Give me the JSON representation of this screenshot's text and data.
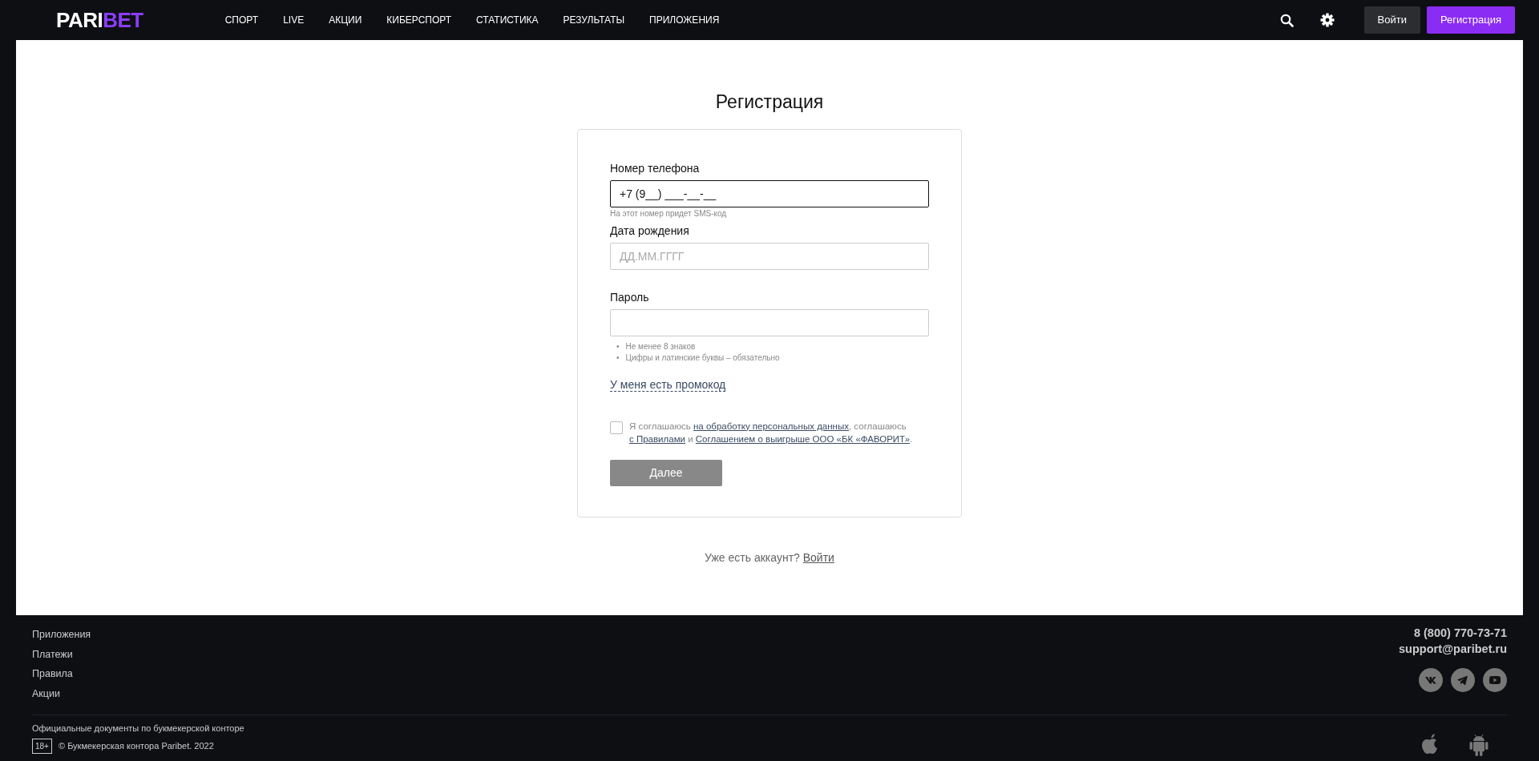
{
  "header": {
    "logo": {
      "light": "PARI",
      "accent": "BET"
    },
    "nav": [
      {
        "label": "СПОРТ"
      },
      {
        "label": "LIVE"
      },
      {
        "label": "АКЦИИ"
      },
      {
        "label": "КИБЕРСПОРТ"
      },
      {
        "label": "СТАТИСТИКА"
      },
      {
        "label": "РЕЗУЛЬТАТЫ"
      },
      {
        "label": "ПРИЛОЖЕНИЯ"
      }
    ],
    "login_button": "Войти",
    "register_button": "Регистрация"
  },
  "form": {
    "title": "Регистрация",
    "fields": [
      {
        "label": "Номер телефона",
        "value": "+7 (9__) ___-__-__",
        "focused": true,
        "hint": "На этот номер придет SMS-код"
      },
      {
        "label": "Дата рождения",
        "placeholder": "ДД.ММ.ГГГГ",
        "focused": false
      },
      {
        "label": "Пароль",
        "focused": false,
        "rules": [
          {
            "bullet": "•",
            "text": "Не менее 8 знаков"
          },
          {
            "bullet": "•",
            "text": "Цифры и латинские буквы – обязательно"
          }
        ]
      }
    ],
    "promo_link": "У меня есть промокод",
    "agreement": {
      "checked": false,
      "parts": [
        {
          "kind": "text",
          "text": "Я соглашаюсь "
        },
        {
          "kind": "link",
          "text": "на обработку персональных данных"
        },
        {
          "kind": "text",
          "text": ", соглашаюсь "
        },
        {
          "kind": "link",
          "text": "с Правилами"
        },
        {
          "kind": "text",
          "text": " и "
        },
        {
          "kind": "link",
          "text": "Соглашением о выигрыше ООО «БК «ФАВОРИТ»"
        },
        {
          "kind": "text",
          "text": "."
        }
      ]
    },
    "submit": {
      "label": "Далее",
      "disabled": true
    },
    "account_prompt": "Уже есть аккаунт?",
    "account_link": "Войти"
  },
  "footer": {
    "links": [
      "Приложения",
      "Платежи",
      "Правила",
      "Акции"
    ],
    "phone": "8 (800) 770-73-71",
    "email": "support@paribet.ru",
    "docs": "Официальные документы по букмекерской конторе",
    "age": "18+",
    "copyright": "© Букмекерская контора Paribet. 2022"
  }
}
